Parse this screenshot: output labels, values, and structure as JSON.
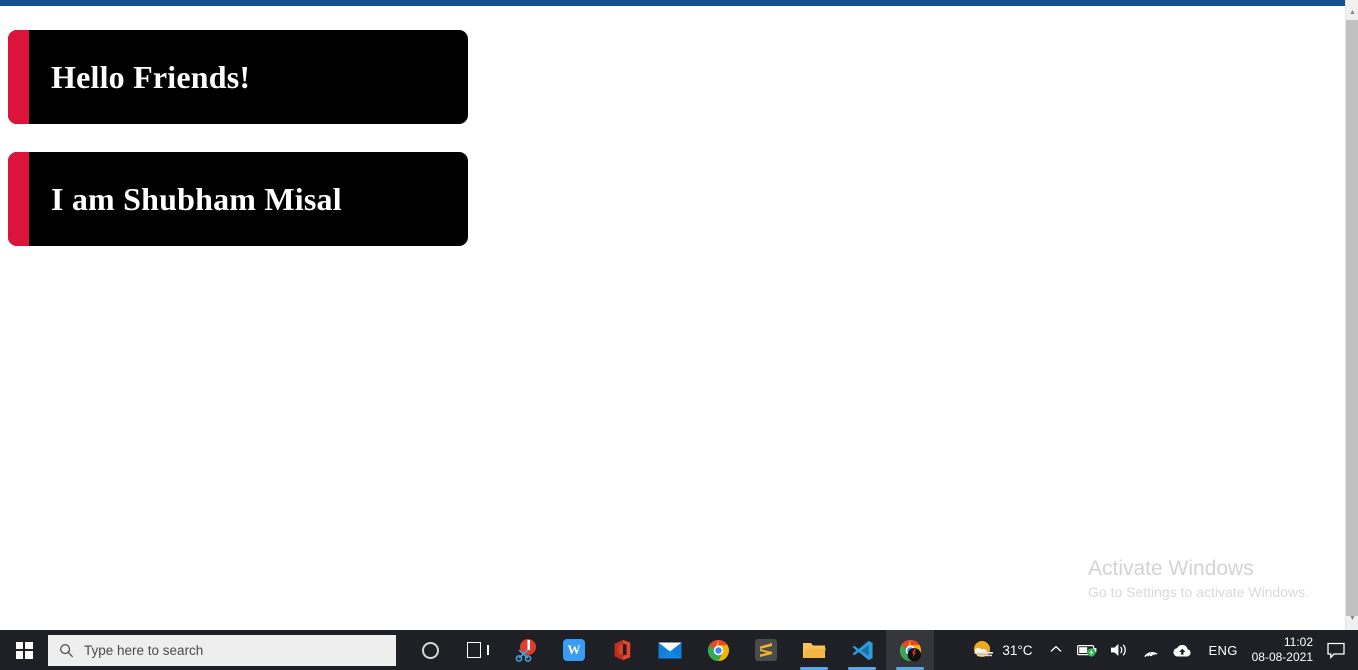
{
  "page": {
    "cards": [
      {
        "text": "Hello Friends!",
        "accent_color": "#dc143c",
        "background": "#000000",
        "text_color": "#ffffff"
      },
      {
        "text": "I am Shubham Misal",
        "accent_color": "#dc143c",
        "background": "#000000",
        "text_color": "#ffffff"
      }
    ],
    "watermark": {
      "title": "Activate Windows",
      "subtitle": "Go to Settings to activate Windows."
    },
    "browser_accent_color": "#14508c"
  },
  "scrollbar": {
    "up_arrow": "▲",
    "down_arrow": "▼"
  },
  "taskbar": {
    "background": "#1f1f26",
    "start_label": "Start",
    "search": {
      "placeholder": "Type here to search",
      "icon": "search-icon"
    },
    "items": [
      {
        "name": "cortana",
        "label": "Cortana",
        "active": false
      },
      {
        "name": "task-view",
        "label": "Task View",
        "active": false
      },
      {
        "name": "snipping-tool",
        "label": "Snip & Sketch",
        "active": false
      },
      {
        "name": "wps-office",
        "label": "WPS Office",
        "active": false,
        "glyph": "W"
      },
      {
        "name": "microsoft-office",
        "label": "Microsoft Office",
        "active": false
      },
      {
        "name": "mail",
        "label": "Mail",
        "active": false
      },
      {
        "name": "google-chrome",
        "label": "Google Chrome",
        "active": false
      },
      {
        "name": "sublime-text",
        "label": "Sublime Text",
        "active": false
      },
      {
        "name": "file-explorer",
        "label": "File Explorer",
        "active": false,
        "running": true
      },
      {
        "name": "visual-studio-code",
        "label": "Visual Studio Code",
        "active": false,
        "running": true
      },
      {
        "name": "chrome-window",
        "label": "Google Chrome",
        "active": true,
        "running": true
      }
    ],
    "tray": {
      "weather_temp": "31°C",
      "weather_icon": "sun-cloud-icon",
      "chevron": "⌃",
      "battery_icon": "battery-icon",
      "volume_icon": "volume-icon",
      "wifi_icon": "wifi-icon",
      "onedrive_icon": "cloud-icon",
      "language": "ENG",
      "time": "11:02",
      "date": "08-08-2021",
      "notifications_icon": "speech-bubble-icon"
    }
  }
}
